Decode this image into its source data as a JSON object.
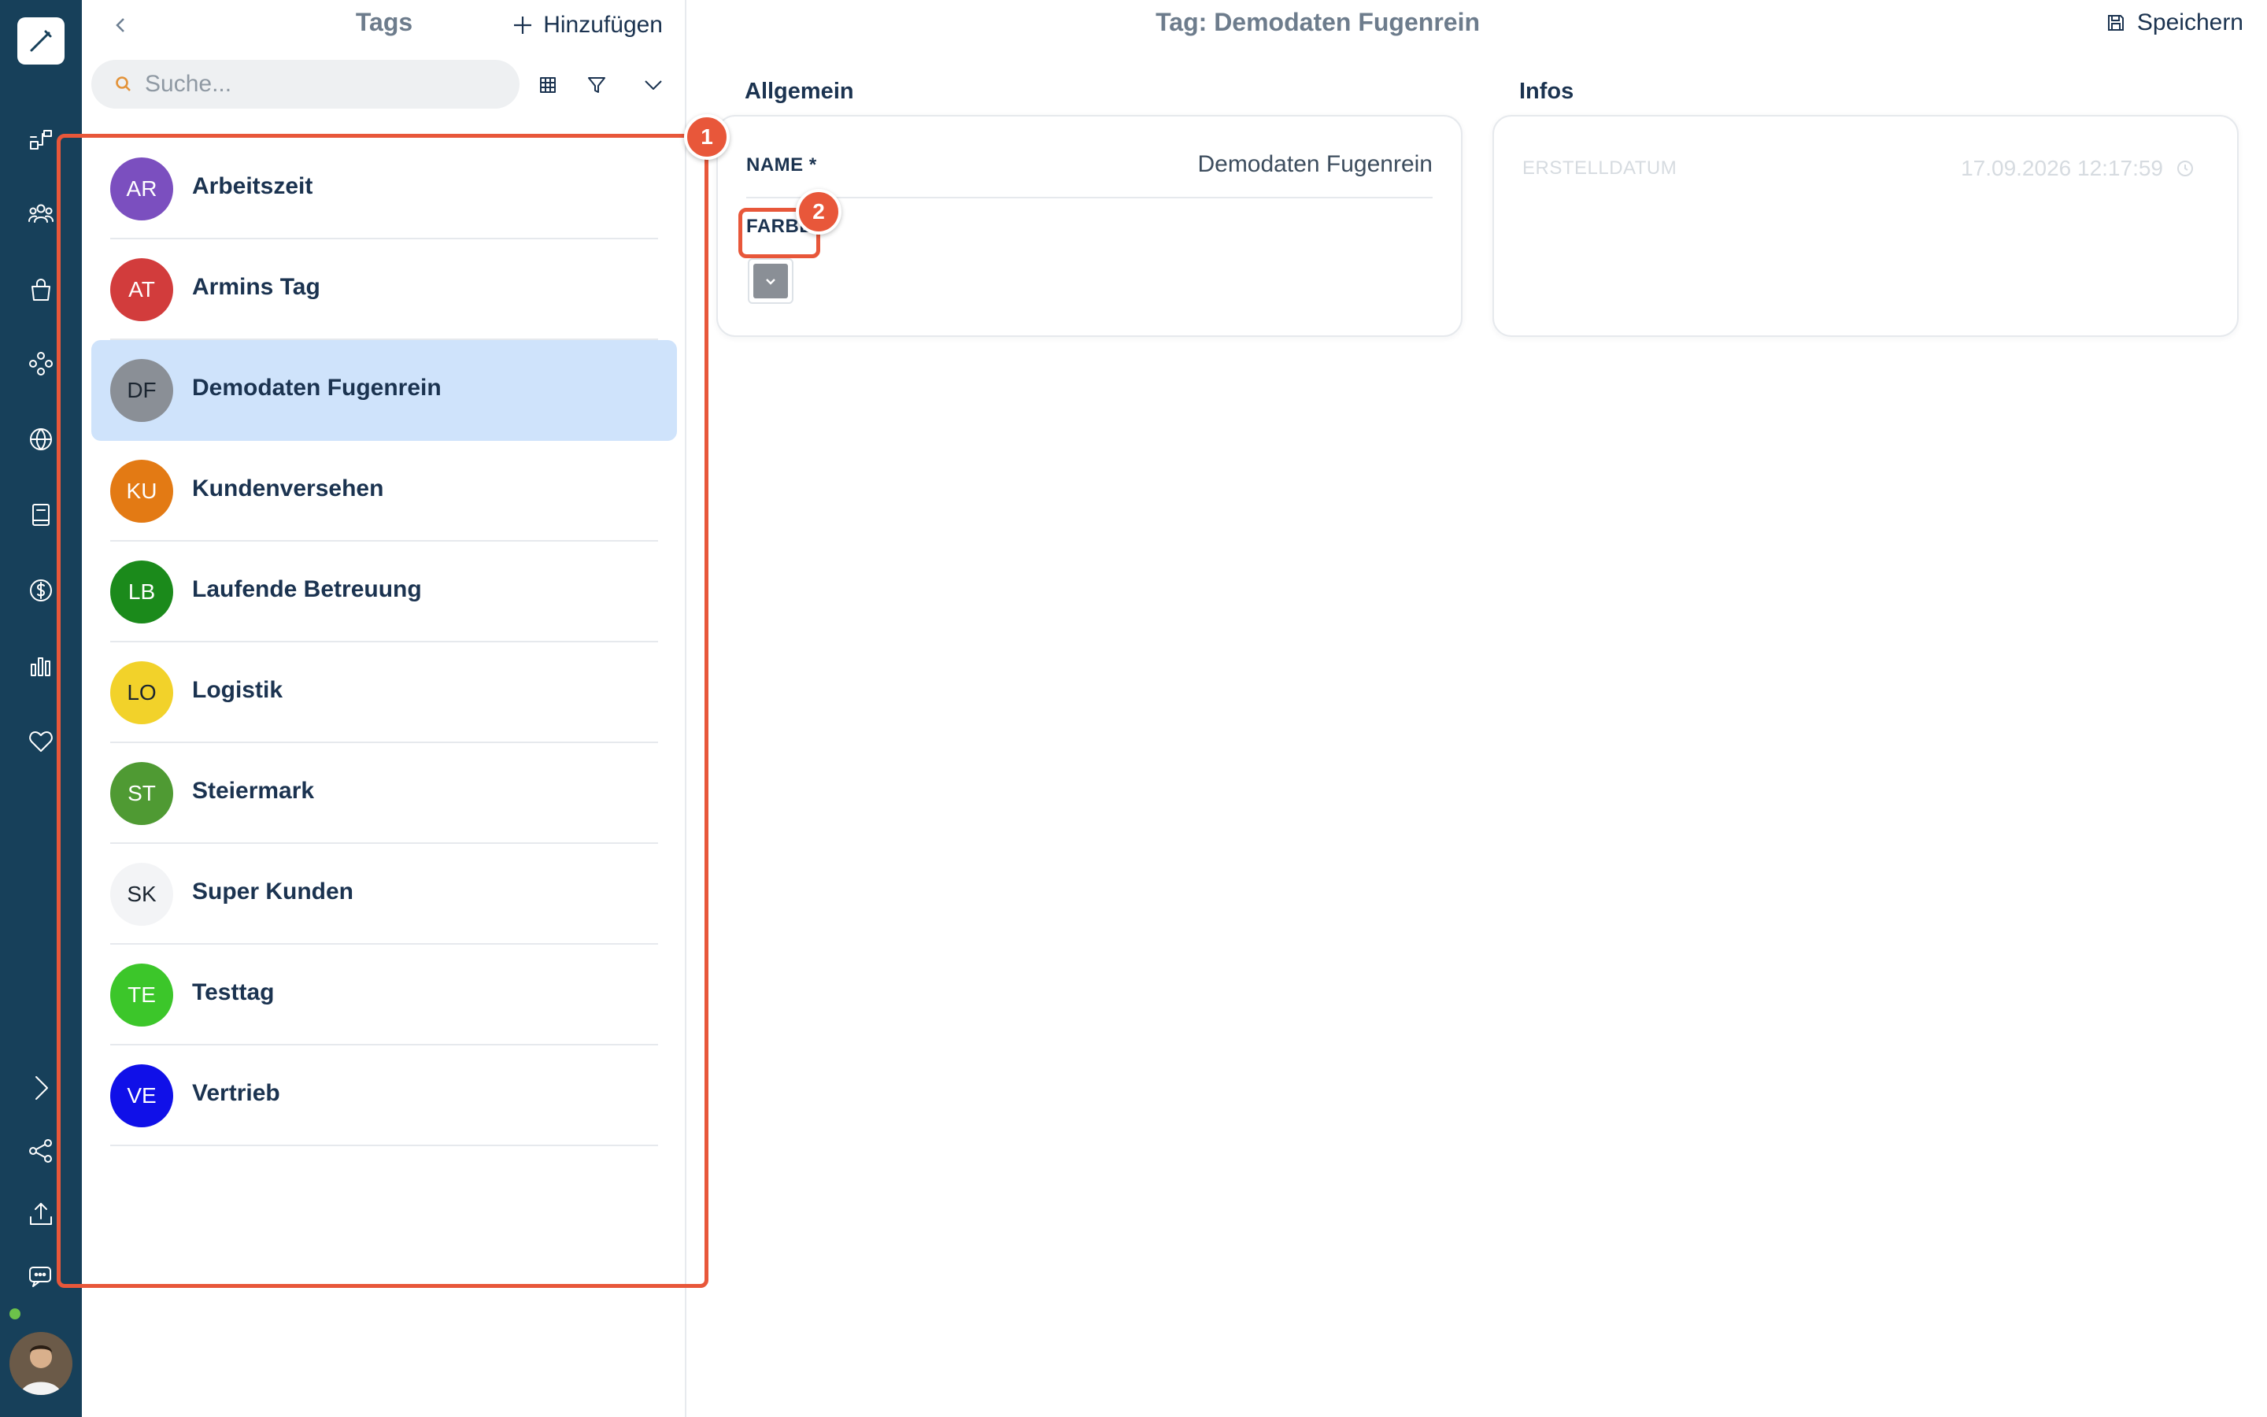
{
  "list_panel": {
    "title": "Tags",
    "add_label": "Hinzufügen",
    "search_placeholder": "Suche...",
    "items": [
      {
        "initials": "AR",
        "name": "Arbeitszeit",
        "color": "#7b4fbf",
        "text_color": "#ffffff",
        "selected": false
      },
      {
        "initials": "AT",
        "name": "Armins Tag",
        "color": "#d23c3c",
        "text_color": "#ffffff",
        "selected": false
      },
      {
        "initials": "DF",
        "name": "Demodaten Fugenrein",
        "color": "#8a8f96",
        "text_color": "#1b2530",
        "selected": true
      },
      {
        "initials": "KU",
        "name": "Kundenversehen",
        "color": "#e37a14",
        "text_color": "#ffffff",
        "selected": false
      },
      {
        "initials": "LB",
        "name": "Laufende Betreuung",
        "color": "#1b8a1b",
        "text_color": "#ffffff",
        "selected": false
      },
      {
        "initials": "LO",
        "name": "Logistik",
        "color": "#f2d22a",
        "text_color": "#1b2530",
        "selected": false
      },
      {
        "initials": "ST",
        "name": "Steiermark",
        "color": "#4f9a33",
        "text_color": "#ffffff",
        "selected": false
      },
      {
        "initials": "SK",
        "name": "Super Kunden",
        "color": "#f3f4f6",
        "text_color": "#1b2530",
        "selected": false
      },
      {
        "initials": "TE",
        "name": "Testtag",
        "color": "#3cc62a",
        "text_color": "#ffffff",
        "selected": false
      },
      {
        "initials": "VE",
        "name": "Vertrieb",
        "color": "#1010e8",
        "text_color": "#ffffff",
        "selected": false
      }
    ]
  },
  "detail": {
    "title": "Tag: Demodaten Fugenrein",
    "save_label": "Speichern",
    "general": {
      "section_label": "Allgemein",
      "name_label": "NAME *",
      "name_value": "Demodaten Fugenrein",
      "color_label": "FARBE",
      "color_value": "#8a8f96"
    },
    "info": {
      "section_label": "Infos",
      "created_label": "ERSTELLDATUM",
      "created_value": "17.09.2026 12:17:59"
    }
  },
  "annotations": [
    {
      "number": "1"
    },
    {
      "number": "2"
    }
  ],
  "icons": {
    "rail": [
      "logo-brush-icon",
      "workflow-icon",
      "users-icon",
      "shopping-bag-icon",
      "modules-icon",
      "globe-icon",
      "book-icon",
      "dollar-icon",
      "bar-chart-icon",
      "heart-icon",
      "expand-chevron-icon",
      "share-icon",
      "upload-icon",
      "chat-icon"
    ]
  }
}
